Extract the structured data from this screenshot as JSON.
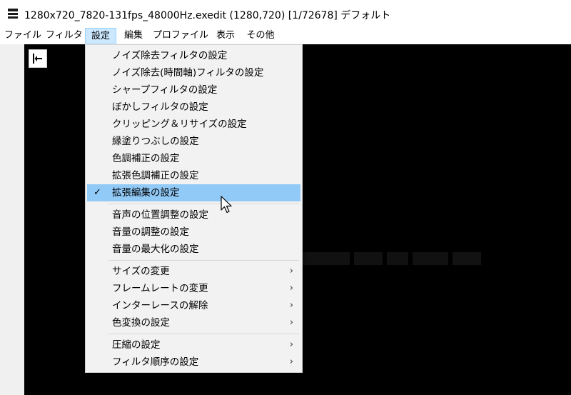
{
  "window": {
    "title": "1280x720_7820-131fps_48000Hz.exedit (1280,720)  [1/72678]  デフォルト",
    "icon": "film-icon"
  },
  "menubar": {
    "items": [
      "ファイル",
      "フィルタ",
      "設定",
      "編集",
      "プロファイル",
      "表示",
      "その他"
    ],
    "active": "設定"
  },
  "dropdown": {
    "group1": [
      {
        "label": "ノイズ除去フィルタの設定"
      },
      {
        "label": "ノイズ除去(時間軸)フィルタの設定"
      },
      {
        "label": "シャープフィルタの設定"
      },
      {
        "label": "ぼかしフィルタの設定"
      },
      {
        "label": "クリッピング＆リサイズの設定"
      },
      {
        "label": "縁塗りつぶしの設定"
      },
      {
        "label": "色調補正の設定"
      },
      {
        "label": "拡張色調補正の設定"
      },
      {
        "label": "拡張編集の設定",
        "checked": true,
        "highlighted": true
      }
    ],
    "group2": [
      {
        "label": "音声の位置調整の設定"
      },
      {
        "label": "音量の調整の設定"
      },
      {
        "label": "音量の最大化の設定"
      }
    ],
    "group3": [
      {
        "label": "サイズの変更",
        "submenu": true
      },
      {
        "label": "フレームレートの変更",
        "submenu": true
      },
      {
        "label": "インターレースの解除",
        "submenu": true
      },
      {
        "label": "色変換の設定",
        "submenu": true
      }
    ],
    "group4": [
      {
        "label": "圧縮の設定",
        "submenu": true
      },
      {
        "label": "フィルタ順序の設定",
        "submenu": true
      }
    ],
    "check_glyph": "✓",
    "submenu_glyph": "›"
  },
  "colors": {
    "highlight": "#91c9f7",
    "menu_active": "#cce8ff",
    "video_bg": "#000000"
  }
}
